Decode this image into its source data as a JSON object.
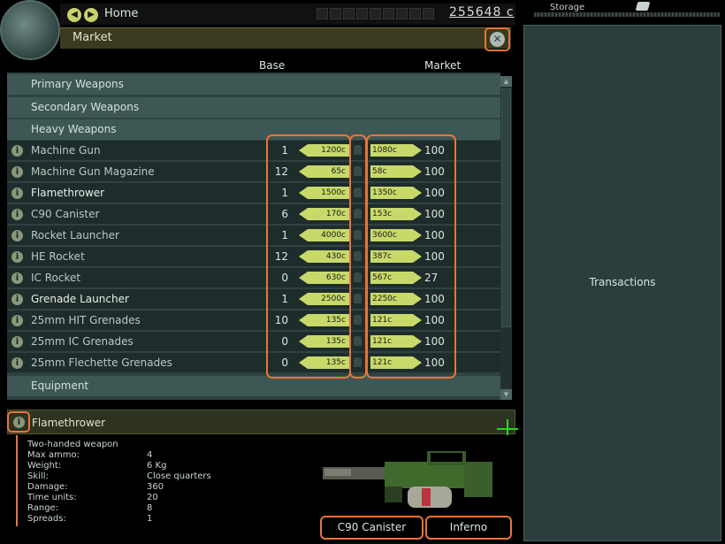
{
  "header": {
    "home_label": "Home",
    "credits": "255648 c"
  },
  "market": {
    "title": "Market",
    "col_base": "Base",
    "col_market": "Market",
    "categories": {
      "primary": "Primary Weapons",
      "secondary": "Secondary Weapons",
      "heavy": "Heavy Weapons",
      "equipment": "Equipment"
    },
    "items": [
      {
        "name": "Machine Gun",
        "qty": "1",
        "base_price": "1200c",
        "market_price": "1080c",
        "market_qty": "100"
      },
      {
        "name": "Machine Gun Magazine",
        "qty": "12",
        "base_price": "65c",
        "market_price": "58c",
        "market_qty": "100"
      },
      {
        "name": "Flamethrower",
        "qty": "1",
        "base_price": "1500c",
        "market_price": "1350c",
        "market_qty": "100"
      },
      {
        "name": "C90 Canister",
        "qty": "6",
        "base_price": "170c",
        "market_price": "153c",
        "market_qty": "100"
      },
      {
        "name": "Rocket Launcher",
        "qty": "1",
        "base_price": "4000c",
        "market_price": "3600c",
        "market_qty": "100"
      },
      {
        "name": "HE Rocket",
        "qty": "12",
        "base_price": "430c",
        "market_price": "387c",
        "market_qty": "100"
      },
      {
        "name": "IC Rocket",
        "qty": "0",
        "base_price": "630c",
        "market_price": "567c",
        "market_qty": "27"
      },
      {
        "name": "Grenade Launcher",
        "qty": "1",
        "base_price": "2500c",
        "market_price": "2250c",
        "market_qty": "100"
      },
      {
        "name": "25mm HIT Grenades",
        "qty": "10",
        "base_price": "135c",
        "market_price": "121c",
        "market_qty": "100"
      },
      {
        "name": "25mm IC Grenades",
        "qty": "0",
        "base_price": "135c",
        "market_price": "121c",
        "market_qty": "100"
      },
      {
        "name": "25mm Flechette Grenades",
        "qty": "0",
        "base_price": "135c",
        "market_price": "121c",
        "market_qty": "100"
      }
    ]
  },
  "detail": {
    "name": "Flamethrower",
    "description": "Two-handed weapon",
    "stats": [
      {
        "label": "Max ammo:",
        "value": "4"
      },
      {
        "label": "Weight:",
        "value": "6 Kg"
      },
      {
        "label": "Skill:",
        "value": "Close quarters"
      },
      {
        "label": "Damage:",
        "value": "360"
      },
      {
        "label": "Time units:",
        "value": "20"
      },
      {
        "label": "Range:",
        "value": "8"
      },
      {
        "label": "Spreads:",
        "value": "1"
      }
    ],
    "ammo_buttons": [
      "C90 Canister",
      "Inferno"
    ]
  },
  "storage": {
    "label": "Storage"
  },
  "transactions": {
    "label": "Transactions"
  },
  "colors": {
    "accent_orange": "#e8743a",
    "price_tag": "#c8d96a",
    "panel_teal": "#2b3d3c",
    "crosshair_green": "#2bd32b"
  }
}
